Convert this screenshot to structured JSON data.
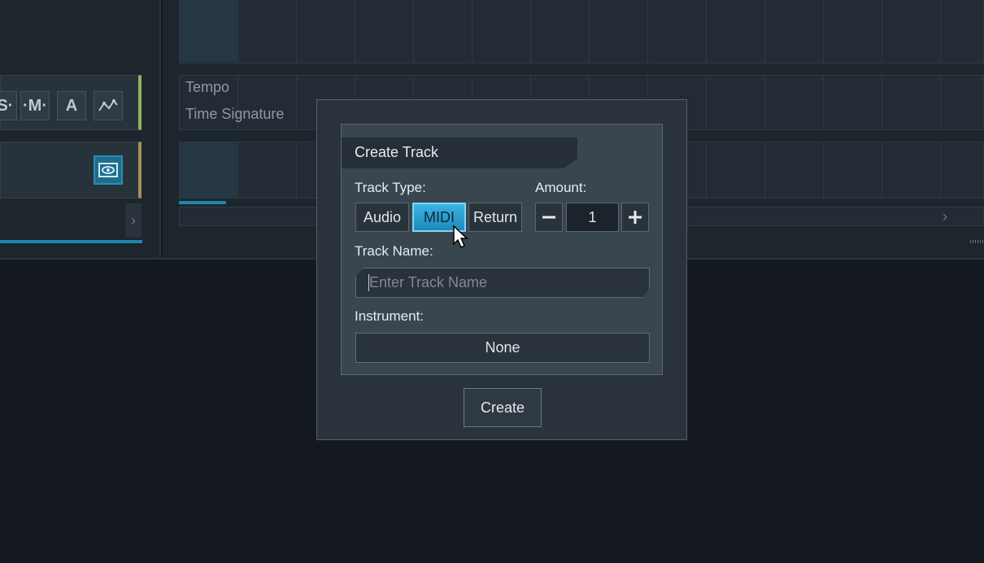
{
  "background": {
    "lanes": {
      "tempo_label": "Tempo",
      "time_signature_label": "Time Signature"
    },
    "track_buttons": {
      "solo_label": "·S·",
      "mute_label": "·M·",
      "arm_label": "A",
      "automation_icon": "automation-curve-icon",
      "eye_icon": "eye-icon"
    },
    "scroll": {
      "left_arrow": "›",
      "right_arrow": "›"
    }
  },
  "dialog": {
    "title": "Create Track",
    "track_type": {
      "label": "Track Type:",
      "options": [
        "Audio",
        "MIDI",
        "Return"
      ],
      "selected": "MIDI"
    },
    "amount": {
      "label": "Amount:",
      "value": "1",
      "decrement_icon": "minus-icon",
      "increment_icon": "plus-icon"
    },
    "track_name": {
      "label": "Track Name:",
      "placeholder": "Enter Track Name",
      "value": ""
    },
    "instrument": {
      "label": "Instrument:",
      "value": "None"
    },
    "create_label": "Create"
  },
  "colors": {
    "accent": "#1e86b0",
    "active_button": "#3bb4e6",
    "track1_color": "#8fb35e",
    "track2_color": "#a48f5c"
  }
}
